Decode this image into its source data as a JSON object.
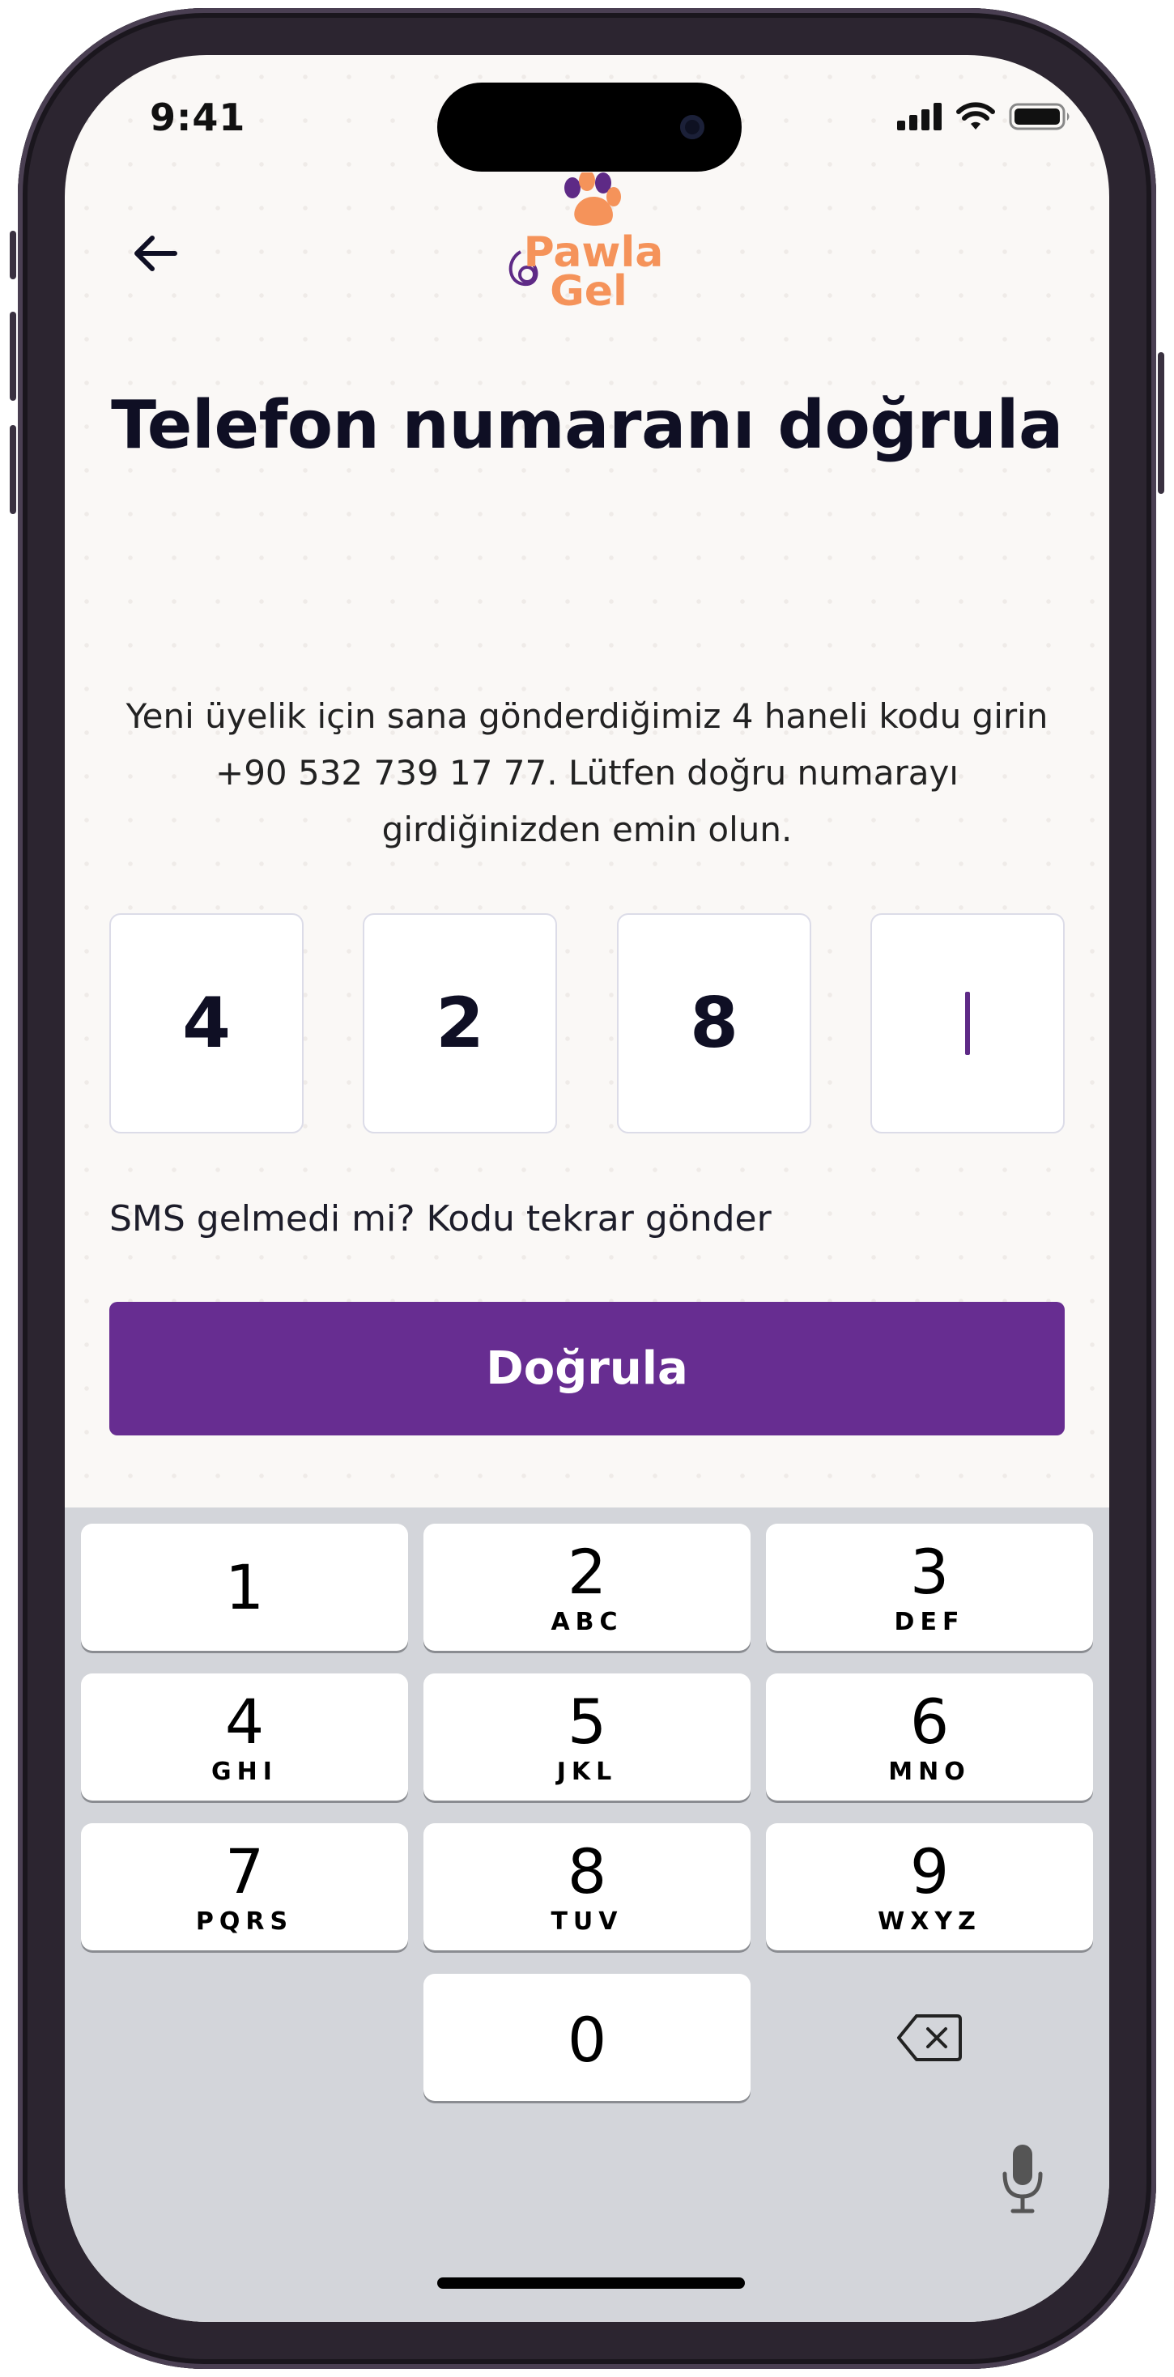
{
  "status_bar": {
    "time": "9:41"
  },
  "header": {
    "back_icon": "arrow-left-icon",
    "logo_line1": "Pawla",
    "logo_line2": "Gel"
  },
  "colors": {
    "brand_purple": "#672d91",
    "brand_orange": "#f5935a",
    "keyboard_bg": "#d3d5da"
  },
  "page": {
    "title": "Telefon numaranı doğrula",
    "description": "Yeni üyelik için sana gönderdiğimiz 4 haneli kodu girin +90 532 739 17 77. Lütfen doğru numarayı girdiğinizden emin olun."
  },
  "otp": {
    "digits": [
      "4",
      "2",
      "8",
      ""
    ]
  },
  "resend_text": "SMS gelmedi mi? Kodu tekrar gönder",
  "verify_button": "Doğrula",
  "keypad": {
    "keys": [
      {
        "num": "1",
        "letters": ""
      },
      {
        "num": "2",
        "letters": "ABC"
      },
      {
        "num": "3",
        "letters": "DEF"
      },
      {
        "num": "4",
        "letters": "GHI"
      },
      {
        "num": "5",
        "letters": "JKL"
      },
      {
        "num": "6",
        "letters": "MNO"
      },
      {
        "num": "7",
        "letters": "PQRS"
      },
      {
        "num": "8",
        "letters": "TUV"
      },
      {
        "num": "9",
        "letters": "WXYZ"
      },
      {
        "num": "0",
        "letters": ""
      }
    ],
    "delete_icon": "backspace-icon",
    "mic_icon": "microphone-icon"
  }
}
